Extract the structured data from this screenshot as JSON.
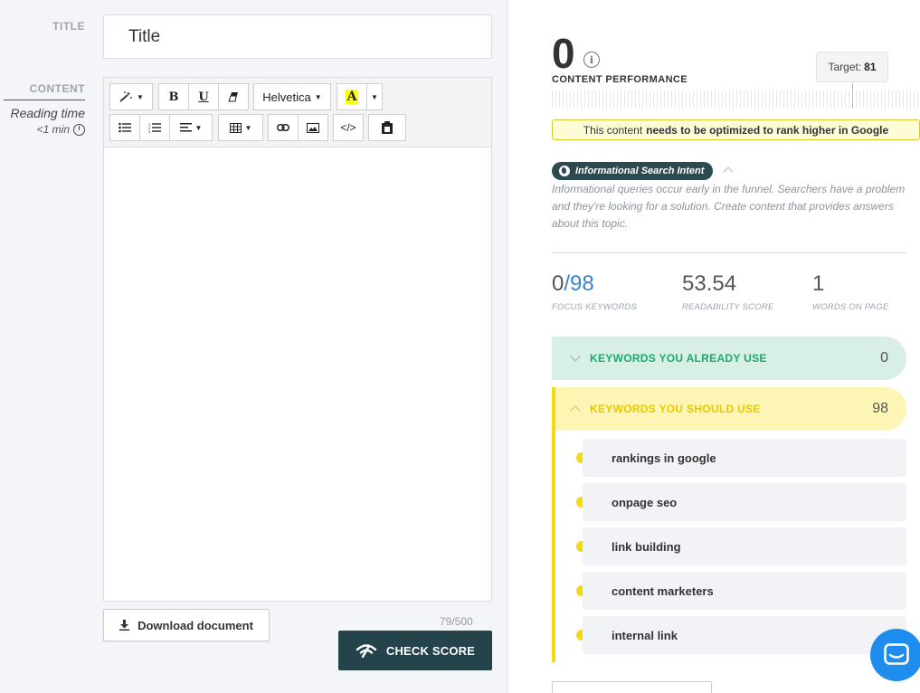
{
  "labels": {
    "title": "TITLE",
    "content": "CONTENT",
    "reading_time": "Reading time",
    "reading_value": "<1 min"
  },
  "title_input": {
    "value": "Title"
  },
  "toolbar": {
    "font_name": "Helvetica",
    "bold": "B",
    "underline": "U",
    "code": "</>"
  },
  "download_label": "Download document",
  "counter": "79/500",
  "check_score_label": "CHECK SCORE",
  "panel": {
    "score": "0",
    "performance_label": "CONTENT PERFORMANCE",
    "target_label": "Target:",
    "target_value": "81",
    "notice_prefix": "This content",
    "notice_bold": "needs to be optimized to rank higher in Google",
    "intent_badge": "Informational Search Intent",
    "intent_description": "Informational queries occur early in the funnel. Searchers have a problem and they're looking for a solution. Create content that provides answers about this topic.",
    "stats": {
      "focus_used": "0",
      "focus_total": "/98",
      "focus_caption": "FOCUS KEYWORDS",
      "readability": "53.54",
      "readability_caption": "READABILITY SCORE",
      "words": "1",
      "words_caption": "WORDS ON PAGE"
    },
    "kw_use_label": "KEYWORDS YOU ALREADY USE",
    "kw_use_count": "0",
    "kw_should_label": "KEYWORDS YOU SHOULD USE",
    "kw_should_count": "98",
    "keywords": [
      "rankings in google",
      "onpage seo",
      "link building",
      "content marketers",
      "internal link"
    ]
  },
  "colors": {
    "check_button": "#24434a",
    "focus_blue": "#3a83d3",
    "kw_use_bg": "#d7efe4",
    "kw_use_text": "#1da86d",
    "kw_should_bg": "#fdf5b4",
    "kw_should_text": "#e8c900",
    "chat": "#1f8ded"
  }
}
